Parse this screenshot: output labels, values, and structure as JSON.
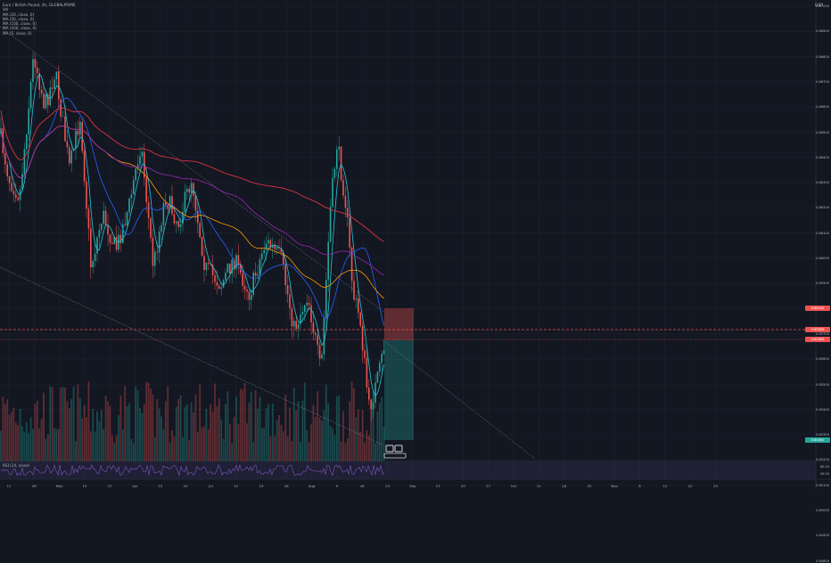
{
  "legend": {
    "title": "Euro / British Pound, 4h, GLOBALPRIME",
    "vol": "Vol",
    "ma": [
      "MA (20, close, 0)",
      "MA (50, close, 0)",
      "MA (100, close, 0)",
      "MA (200, close, 0)",
      "MA (5, close, 0)"
    ]
  },
  "currency": "GBP",
  "rsi_label": "RSI (14, close)",
  "colors": {
    "up": "#26a69a",
    "down": "#ef5350",
    "ma20": "#2962ff",
    "ma50": "#ff9800",
    "ma100": "#9c27b0",
    "ma200": "#f23645",
    "ma5": "#26c6da",
    "background": "#131722"
  },
  "price_axis": [
    "0.87000",
    "0.86900",
    "0.86800",
    "0.86700",
    "0.86600",
    "0.86500",
    "0.86400",
    "0.86300",
    "0.86200",
    "0.86100",
    "0.86000",
    "0.85900",
    "0.85800",
    "0.85700",
    "0.85600",
    "0.85500",
    "0.85400",
    "0.85300",
    "0.85200",
    "0.85100",
    "0.85000",
    "0.84900",
    "0.84800"
  ],
  "badges": {
    "stop": "0.86245",
    "entry": "0.85898",
    "current": "0.85883",
    "target": "0.84800"
  },
  "rsi_axis": [
    "60.00",
    "40.00"
  ],
  "date_axis": [
    "11",
    "26",
    "May",
    "15",
    "27",
    "Jun",
    "15",
    "24",
    "Jul",
    "12",
    "19",
    "26",
    "Aug",
    "9",
    "16",
    "23",
    "Sep",
    "13",
    "20",
    "27",
    "Oct",
    "11",
    "18",
    "25",
    "Nov",
    "8",
    "15",
    "22",
    "29"
  ]
}
